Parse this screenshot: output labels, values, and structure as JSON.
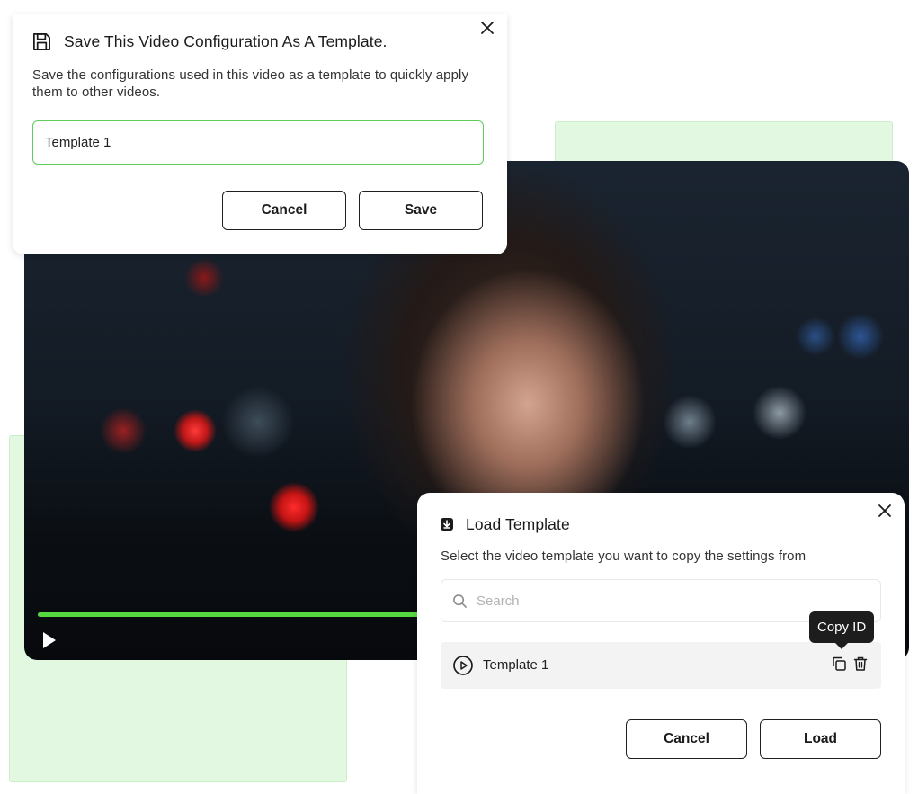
{
  "save_dialog": {
    "title": "Save This Video Configuration As A Template.",
    "description": "Save the configurations used in this video as a template to quickly apply them to other videos.",
    "input_value": "Template 1",
    "cancel_label": "Cancel",
    "save_label": "Save",
    "icon": "floppy-disk-icon"
  },
  "video_player": {
    "progress": 0.72,
    "progress_color": "#56d841",
    "play_icon": "play-icon"
  },
  "load_dialog": {
    "title": "Load Template",
    "description": "Select the video template you want to copy the settings from",
    "search_placeholder": "Search",
    "templates": [
      {
        "label": "Template 1"
      }
    ],
    "tooltip": "Copy ID",
    "cancel_label": "Cancel",
    "load_label": "Load",
    "icon": "download-icon"
  },
  "colors": {
    "accent": "#56d841",
    "accent_border": "#5ecb5a",
    "decor_panel": "#e2f8e1",
    "tooltip_bg": "#1d1d1d"
  }
}
